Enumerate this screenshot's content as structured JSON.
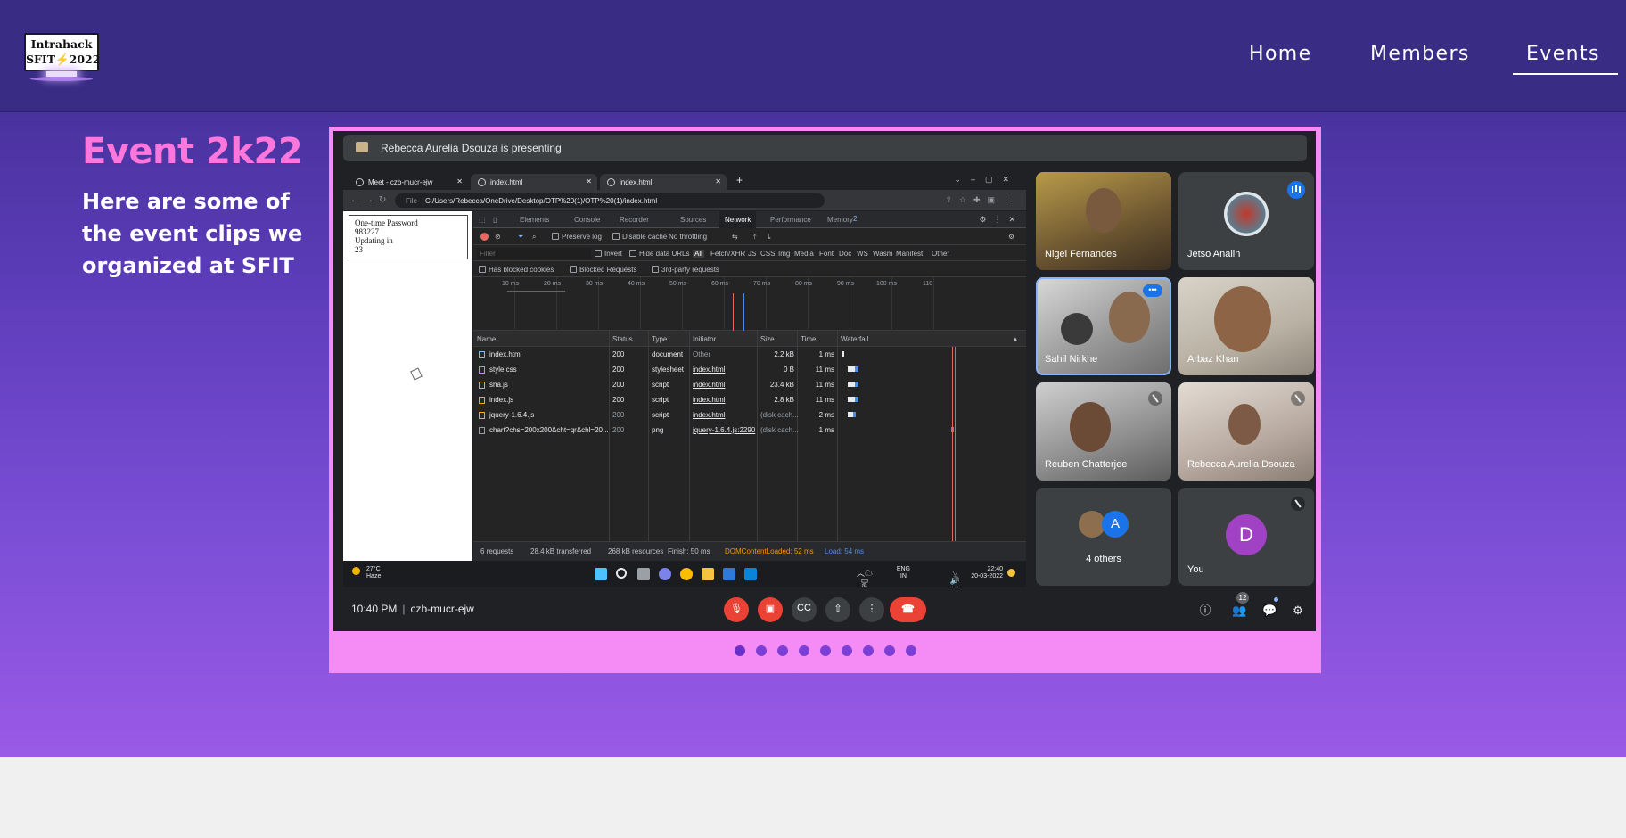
{
  "nav": {
    "home": "Home",
    "members": "Members",
    "events": "Events",
    "active": "Events"
  },
  "logo": {
    "line1": "Intrahack",
    "line2a": "SFIT",
    "line2b": "2022"
  },
  "hero": {
    "title": "Event 2k22",
    "description": "Here are some of the event clips we organized at SFIT"
  },
  "carousel": {
    "slide_count": 9,
    "active_index": 0
  },
  "meet": {
    "presenting": "Rebecca Aurelia Dsouza is presenting",
    "time": "10:40 PM",
    "meeting_code": "czb-mucr-ejw",
    "people_count": "12",
    "participants": [
      {
        "name": "Nigel Fernandes"
      },
      {
        "name": "Jetso Analin"
      },
      {
        "name": "Sahil Nirkhe"
      },
      {
        "name": "Arbaz Khan"
      },
      {
        "name": "Reuben Chatterjee"
      },
      {
        "name": "Rebecca Aurelia Dsouza"
      },
      {
        "name": "4 others",
        "avatar_letter": "A"
      },
      {
        "name": "You",
        "avatar_letter": "D"
      }
    ]
  },
  "browser": {
    "tabs": [
      "Meet - czb-mucr-ejw",
      "index.html",
      "index.html"
    ],
    "url_label": "File",
    "url": "C:/Users/Rebecca/OneDrive/Desktop/OTP%20(1)/OTP%20(1)/index.html",
    "page_lines": [
      "One-time Password",
      "983227",
      "Updating in",
      "23"
    ],
    "devtools_tabs": [
      "Elements",
      "Console",
      "Recorder",
      "Sources",
      "Network",
      "Performance",
      "Memory"
    ],
    "devtools_active": "Network",
    "badge": "2",
    "toolbar": {
      "preserve_log": "Preserve log",
      "disable_cache": "Disable cache",
      "throttling": "No throttling"
    },
    "filter": {
      "placeholder": "Filter",
      "invert": "Invert",
      "hide_data_urls": "Hide data URLs",
      "types": [
        "All",
        "Fetch/XHR",
        "JS",
        "CSS",
        "Img",
        "Media",
        "Font",
        "Doc",
        "WS",
        "Wasm",
        "Manifest",
        "Other"
      ]
    },
    "filter2": [
      "Has blocked cookies",
      "Blocked Requests",
      "3rd-party requests"
    ],
    "timeline_ticks": [
      "10 ms",
      "20 ms",
      "30 ms",
      "40 ms",
      "50 ms",
      "60 ms",
      "70 ms",
      "80 ms",
      "90 ms",
      "100 ms",
      "110"
    ],
    "columns": [
      "Name",
      "Status",
      "Type",
      "Initiator",
      "Size",
      "Time",
      "Waterfall"
    ],
    "rows": [
      {
        "name": "index.html",
        "status": "200",
        "type": "document",
        "initiator": "Other",
        "size": "2.2 kB",
        "time": "1 ms"
      },
      {
        "name": "style.css",
        "status": "200",
        "type": "stylesheet",
        "initiator": "index.html",
        "size": "0 B",
        "time": "11 ms"
      },
      {
        "name": "sha.js",
        "status": "200",
        "type": "script",
        "initiator": "index.html",
        "size": "23.4 kB",
        "time": "11 ms"
      },
      {
        "name": "index.js",
        "status": "200",
        "type": "script",
        "initiator": "index.html",
        "size": "2.8 kB",
        "time": "11 ms"
      },
      {
        "name": "jquery-1.6.4.js",
        "status": "200",
        "type": "script",
        "initiator": "index.html",
        "size": "(disk cach...",
        "time": "2 ms"
      },
      {
        "name": "chart?chs=200x200&cht=qr&chl=20...",
        "status": "200",
        "type": "png",
        "initiator": "jquery-1.6.4.js:2290",
        "size": "(disk cach...",
        "time": "1 ms"
      }
    ],
    "status": {
      "requests": "6 requests",
      "transferred": "28.4 kB transferred",
      "resources": "268 kB resources",
      "finish": "Finish: 50 ms",
      "dcl": "DOMContentLoaded: 52 ms",
      "load": "Load: 54 ms"
    },
    "taskbar": {
      "temp": "27°C",
      "weather": "Haze",
      "lang": "ENG",
      "region": "IN",
      "clock": "22:40",
      "date": "20-03-2022"
    }
  },
  "colors": {
    "accent_pink": "#ff77dd",
    "nav_bg": "#392c85",
    "carousel_bg": "#f58cf5",
    "dot": "#7c3fd6"
  }
}
